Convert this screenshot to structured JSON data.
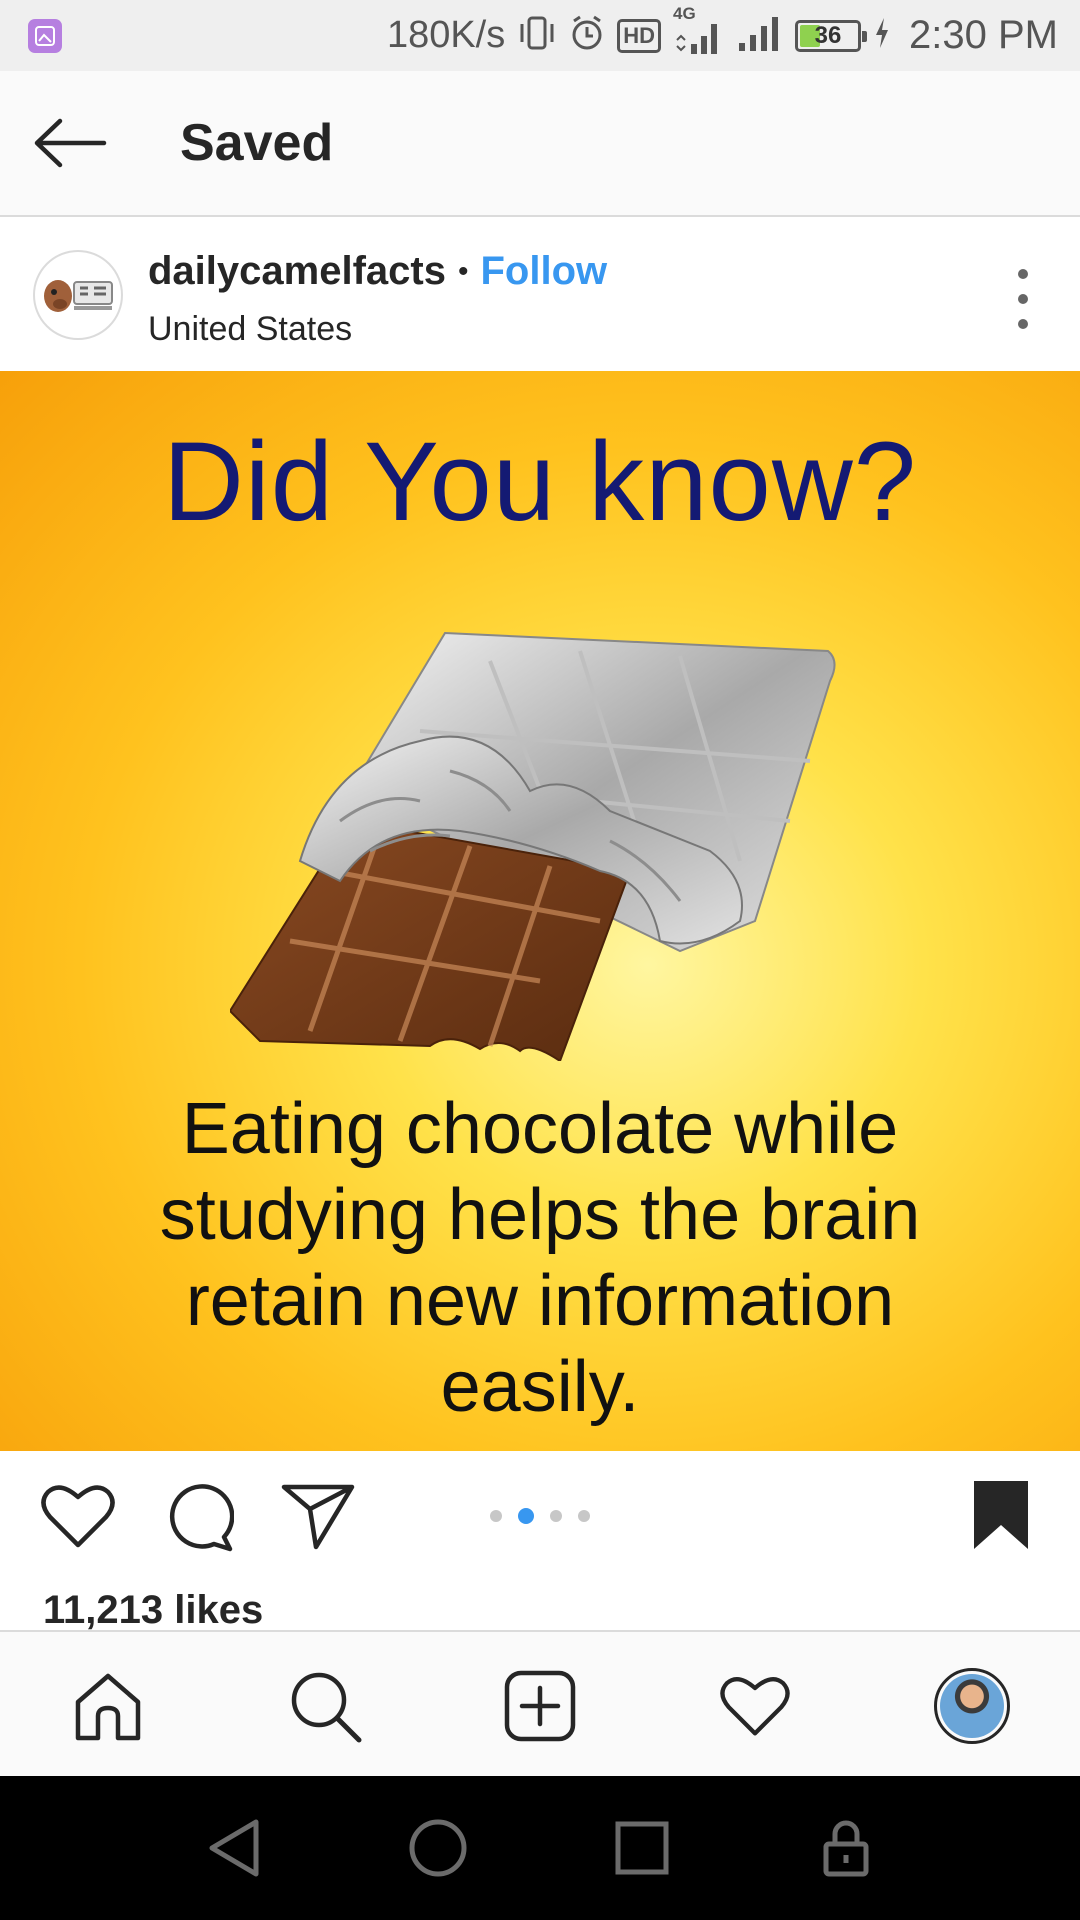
{
  "status_bar": {
    "speed": "180K/s",
    "network": "4G",
    "hd": "HD",
    "battery_level": "36",
    "battery_fraction": 0.36,
    "time": "2:30 PM"
  },
  "header": {
    "title": "Saved"
  },
  "post": {
    "username": "dailycamelfacts",
    "separator": "•",
    "follow_label": "Follow",
    "location": "United States",
    "image": {
      "headline": "Did You know?",
      "body_lines": [
        "Eating chocolate while",
        "studying helps the brain",
        "retain new information",
        "easily."
      ]
    },
    "carousel": {
      "count": 4,
      "active_index": 1
    },
    "likes": "11,213 likes"
  },
  "colors": {
    "accent": "#3897f0",
    "headline": "#141a73",
    "image_bg": "#ffc21e",
    "battery_fill": "#8fd14f"
  },
  "icons": {
    "back": "arrow-left-icon",
    "more": "more-vertical-icon",
    "like": "heart-icon",
    "comment": "comment-icon",
    "share": "send-icon",
    "save": "bookmark-filled-icon",
    "home": "home-icon",
    "search": "search-icon",
    "new_post": "plus-square-icon",
    "activity": "heart-icon",
    "profile": "avatar"
  }
}
